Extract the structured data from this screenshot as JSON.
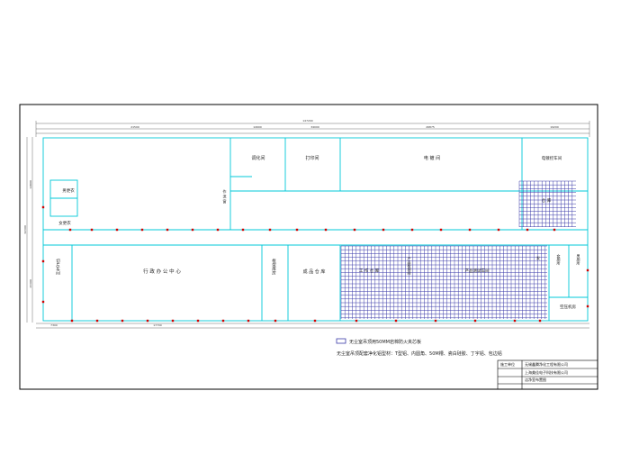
{
  "rooms": {
    "tiaohua": "调化间",
    "dayin": "打印间",
    "diandu": "电 镀 间",
    "diandu_kongzhi": "电镀控车间",
    "fuyao": "仓 库",
    "nan_gengyi": "男更衣",
    "nv_gengyi": "女更衣",
    "huanxi": "作 流 窗",
    "tiaopian": "切片车间",
    "xingzheng": "行 政 办 公 中 心",
    "kuanjia": "框架库房",
    "chengpin": "成 品 仓 库",
    "gongyi": "工 作 仓 库",
    "chanpin_ceshi": "产品测试间",
    "chanpin_cejian": "产品检测间",
    "chanpin_shiyan": "产品测试车间",
    "jiuguang": "发",
    "nan_ce": "男厕所",
    "nv_ce": "女厕所",
    "kongya": "空压机房"
  },
  "dimensions": {
    "total": "147200",
    "upper_left": "21500",
    "upper_mid": "14900",
    "upper_mid2": "34000",
    "upper_right": "26875",
    "upper_far": "19200",
    "lower_a": "7300",
    "lower_b": "17700",
    "height_total": "32300",
    "height_upper": "14800",
    "height_lower": "15300"
  },
  "legend": {
    "swatch_label": "无尘室吊顶用50MM岩棉防火夹芯板",
    "note": "无尘室吊顶配套净化铝型材：T型铝、内圆角、50M槽、瓷白硅胶、丁字铝、包边铝"
  },
  "title_block": {
    "row1_label": "施工单位",
    "row1_value": "无锡鑫腾净化工程有限公司",
    "row2_label": "",
    "row2_value": "上海美佳电子科技有限公司",
    "row3_label": "",
    "row3_value": "洁净室布置图"
  },
  "colors": {
    "wall": "#00c8d8",
    "grid": "#3a3aa8",
    "grid_alt": "#d040c0",
    "door": "#d00000",
    "frame": "#000000"
  }
}
